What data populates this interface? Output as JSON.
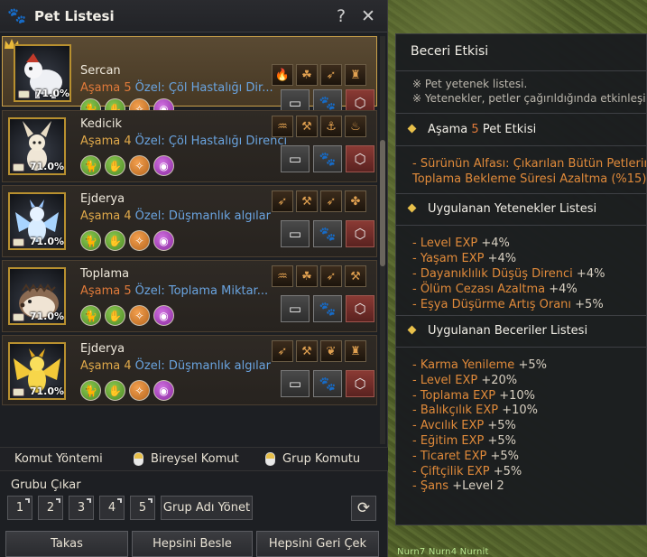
{
  "window": {
    "title": "Pet Listesi",
    "help": "?",
    "close": "✕"
  },
  "pets": [
    {
      "name": "Sercan",
      "tier_label": "Aşama 5",
      "special": "Özel: Çöl Hastalığı Dir...",
      "hunger": "71.0%",
      "selected": true
    },
    {
      "name": "Kedicik",
      "tier_label": "Aşama 4",
      "special": "Özel: Çöl Hastalığı Direnci",
      "hunger": "71.0%",
      "selected": false
    },
    {
      "name": "Ejderya",
      "tier_label": "Aşama 4",
      "special": "Özel: Düşmanlık algılar",
      "hunger": "71.0%",
      "selected": false
    },
    {
      "name": "Toplama",
      "tier_label": "Aşama 5",
      "special": "Özel: Toplama Miktar...",
      "hunger": "71.0%",
      "selected": false
    },
    {
      "name": "Ejderya",
      "tier_label": "Aşama 4",
      "special": "Özel: Düşmanlık algılar",
      "hunger": "71.0%",
      "selected": false
    }
  ],
  "command": {
    "label": "Komut Yöntemi",
    "individual": "Bireysel Komut",
    "group": "Grup Komutu"
  },
  "groups": {
    "title": "Grubu Çıkar",
    "buttons": [
      "1",
      "2",
      "3",
      "4",
      "5"
    ],
    "manage": "Grup Adı Yönet"
  },
  "bottom": {
    "takas": "Takas",
    "feed_all": "Hepsini Besle",
    "recall_all": "Hepsini Geri Çek"
  },
  "effect": {
    "title": "Beceri Etkisi",
    "notes": [
      "※ Pet yetenek listesi.",
      "※ Yetenekler, petler çağırıldığında etkinleşir."
    ],
    "stage_prefix": "Aşama ",
    "stage_num": "5",
    "stage_suffix": " Pet Etkisi",
    "stage_lines": [
      "- Sürünün Alfası: Çıkarılan Bütün Petlerin",
      "Toplama Bekleme Süresi Azaltma (%15)"
    ],
    "applied_skills_title": "Uygulanan Yetenekler Listesi",
    "applied_skills": [
      {
        "name": "- Level EXP",
        "value": " +4%"
      },
      {
        "name": "- Yaşam EXP",
        "value": " +4%"
      },
      {
        "name": "- Dayanıklılık Düşüş Direnci",
        "value": " +4%"
      },
      {
        "name": "- Ölüm Cezası Azaltma",
        "value": " +4%"
      },
      {
        "name": "- Eşya Düşürme Artış Oranı",
        "value": " +5%"
      }
    ],
    "applied_buffs_title": "Uygulanan Beceriler Listesi",
    "applied_buffs": [
      {
        "name": "- Karma Yenileme",
        "value": " +5%"
      },
      {
        "name": "- Level EXP",
        "value": " +20%"
      },
      {
        "name": "- Toplama EXP",
        "value": " +10%"
      },
      {
        "name": "- Balıkçılık EXP",
        "value": " +10%"
      },
      {
        "name": "- Avcılık EXP",
        "value": " +5%"
      },
      {
        "name": "- Eğitim EXP",
        "value": " +5%"
      },
      {
        "name": "- Ticaret EXP",
        "value": " +5%"
      },
      {
        "name": "- Çiftçilik EXP",
        "value": " +5%"
      },
      {
        "name": "- Şans",
        "value": " +Level 2"
      }
    ]
  },
  "world": {
    "nameplates": "Nurn7  Nurn4  Nurnit"
  },
  "colors": {
    "accent_gold": "#c9a04a",
    "tier_orange": "#e07a3a",
    "special_blue": "#6aa4e0"
  }
}
